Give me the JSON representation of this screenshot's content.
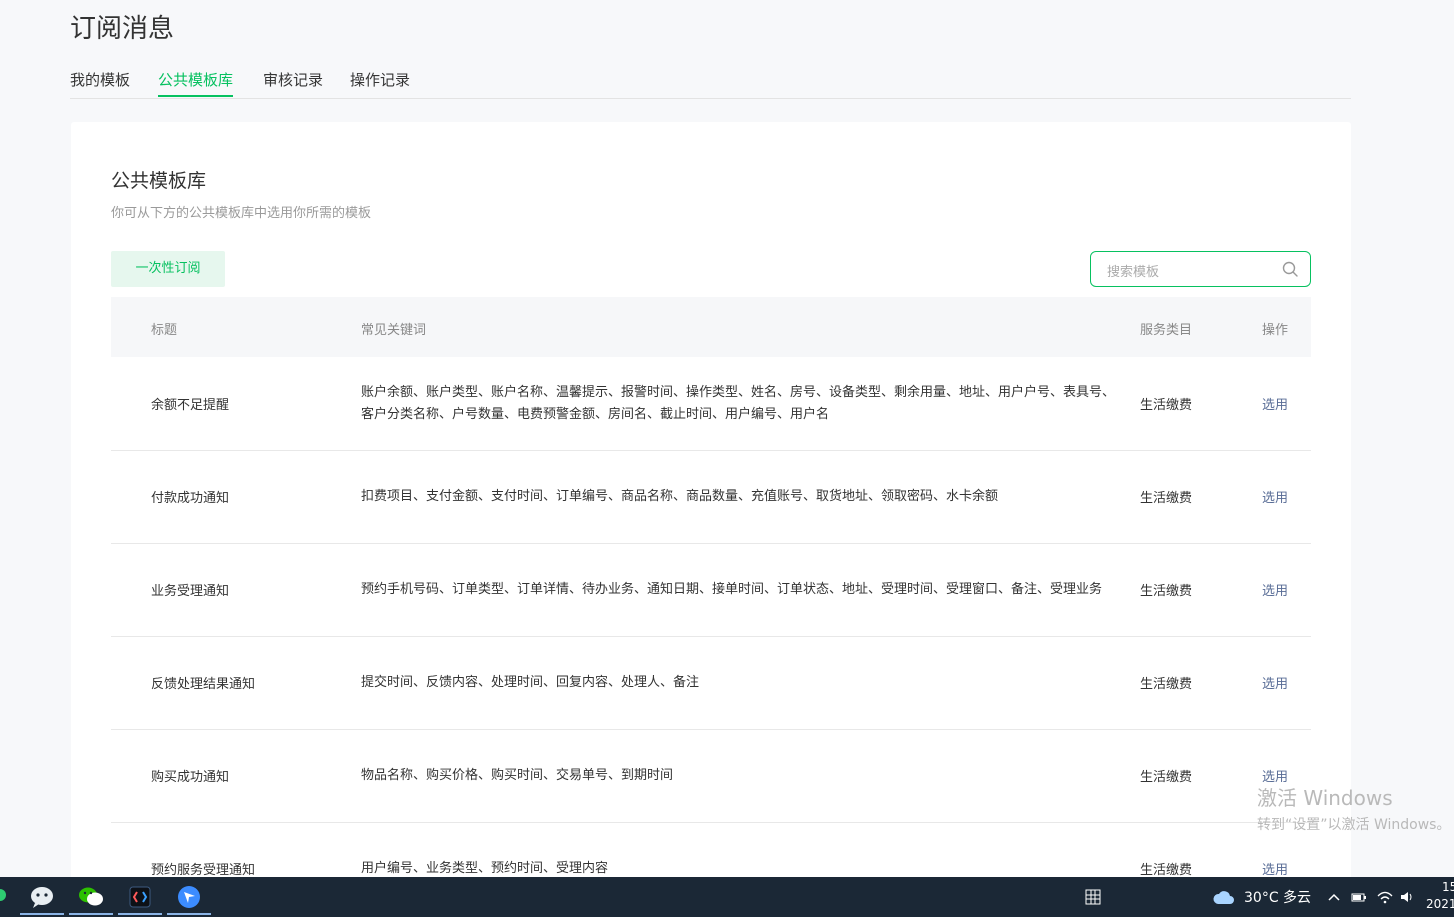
{
  "page": {
    "title": "订阅消息"
  },
  "tabs": [
    {
      "label": "我的模板",
      "active": false
    },
    {
      "label": "公共模板库",
      "active": true
    },
    {
      "label": "审核记录",
      "active": false
    },
    {
      "label": "操作记录",
      "active": false
    }
  ],
  "section": {
    "title": "公共模板库",
    "desc": "你可从下方的公共模板库中选用你所需的模板"
  },
  "buttons": {
    "once": "一次性订阅"
  },
  "search": {
    "placeholder": "搜索模板",
    "icon": "search-icon"
  },
  "table": {
    "headers": {
      "title": "标题",
      "keywords": "常见关键词",
      "service": "服务类目",
      "op": "操作"
    },
    "rows": [
      {
        "title": "余额不足提醒",
        "keywords": "账户余额、账户类型、账户名称、温馨提示、报警时间、操作类型、姓名、房号、设备类型、剩余用量、地址、用户户号、表具号、客户分类名称、户号数量、电费预警金额、房间名、截止时间、用户编号、用户名",
        "service": "生活缴费",
        "op": "选用"
      },
      {
        "title": "付款成功通知",
        "keywords": "扣费项目、支付金额、支付时间、订单编号、商品名称、商品数量、充值账号、取货地址、领取密码、水卡余额",
        "service": "生活缴费",
        "op": "选用"
      },
      {
        "title": "业务受理通知",
        "keywords": "预约手机号码、订单类型、订单详情、待办业务、通知日期、接单时间、订单状态、地址、受理时间、受理窗口、备注、受理业务",
        "service": "生活缴费",
        "op": "选用"
      },
      {
        "title": "反馈处理结果通知",
        "keywords": "提交时间、反馈内容、处理时间、回复内容、处理人、备注",
        "service": "生活缴费",
        "op": "选用"
      },
      {
        "title": "购买成功通知",
        "keywords": "物品名称、购买价格、购买时间、交易单号、到期时间",
        "service": "生活缴费",
        "op": "选用"
      },
      {
        "title": "预约服务受理通知",
        "keywords": "用户编号、业务类型、预约时间、受理内容",
        "service": "生活缴费",
        "op": "选用"
      }
    ]
  },
  "watermark": {
    "line1": "激活 Windows",
    "line2": "转到“设置”以激活 Windows。"
  },
  "taskbar": {
    "weather": "30°C 多云",
    "time": "15",
    "date": "2021",
    "apps": [
      "chat-app-icon",
      "wechat-icon",
      "code-editor-icon",
      "feishu-icon"
    ]
  },
  "colors": {
    "accent": "#07c160",
    "link": "#576b95",
    "taskbar": "#1b2836"
  }
}
